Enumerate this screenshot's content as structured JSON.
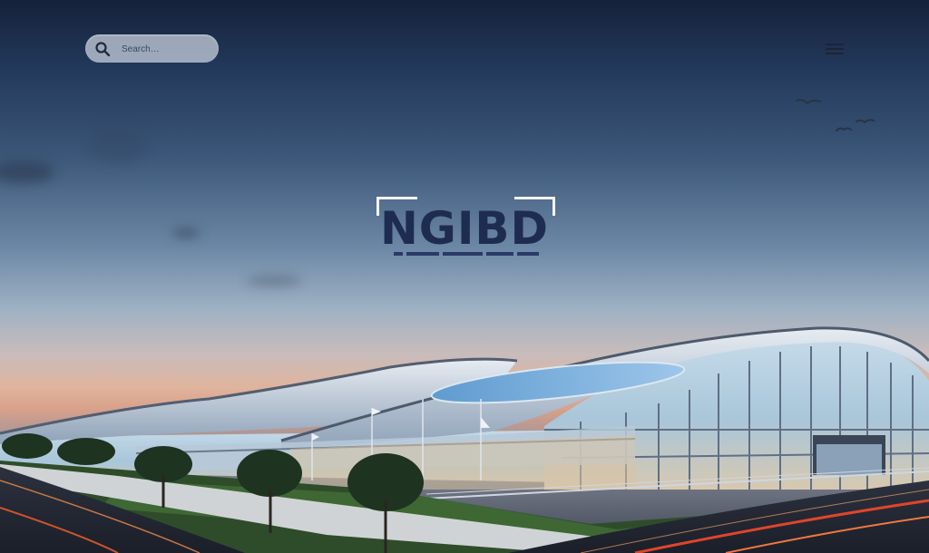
{
  "header": {
    "search": {
      "value": "",
      "placeholder": "Search…",
      "icon": "search-icon"
    },
    "menu": {
      "icon": "hamburger-menu-icon"
    }
  },
  "hero": {
    "logo": {
      "text": "NGIBD"
    }
  },
  "colors": {
    "logo": "#1f2c52",
    "sky_top": "#16213a",
    "horizon": "#e0b49d",
    "glass": "#9ec4de"
  }
}
